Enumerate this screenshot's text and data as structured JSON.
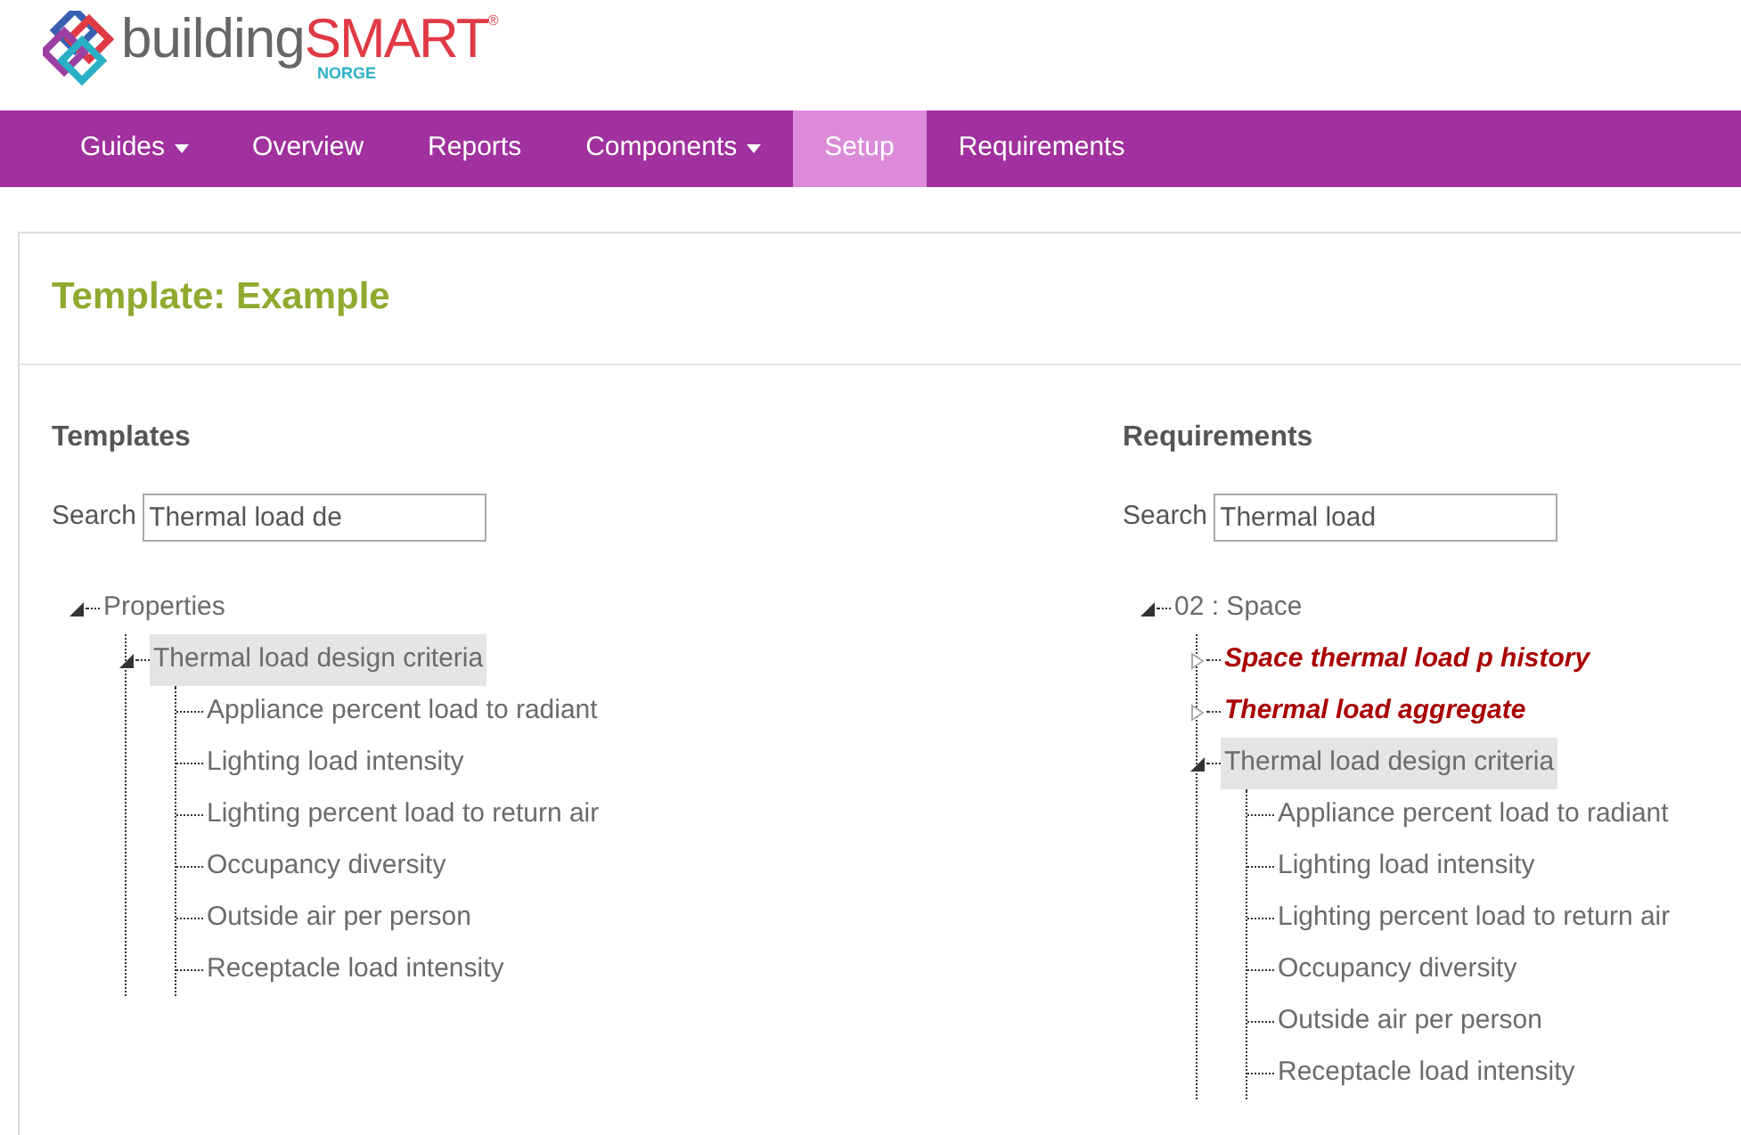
{
  "logo": {
    "wordmark": "building",
    "brand": "SMART",
    "registered": "®",
    "country": "NORGE"
  },
  "nav": [
    {
      "label": "Guides",
      "dropdown": true,
      "selected": false
    },
    {
      "label": "Overview",
      "dropdown": false,
      "selected": false
    },
    {
      "label": "Reports",
      "dropdown": false,
      "selected": false
    },
    {
      "label": "Components",
      "dropdown": true,
      "selected": false
    },
    {
      "label": "Setup",
      "dropdown": false,
      "selected": true
    },
    {
      "label": "Requirements",
      "dropdown": false,
      "selected": false
    }
  ],
  "page_title": "Template: Example",
  "panels": [
    {
      "heading": "Templates",
      "search": {
        "label": "Search",
        "value": "Thermal load de"
      },
      "tree": [
        {
          "label": "Properties",
          "kind": "normal",
          "expanded": true,
          "selected": false,
          "children": [
            {
              "label": "Thermal load design criteria",
              "kind": "normal",
              "expanded": true,
              "selected": true,
              "children": [
                {
                  "label": "Appliance percent load to radiant",
                  "kind": "normal",
                  "selected": false
                },
                {
                  "label": "Lighting load intensity",
                  "kind": "normal",
                  "selected": false
                },
                {
                  "label": "Lighting percent load to return air",
                  "kind": "normal",
                  "selected": false
                },
                {
                  "label": "Occupancy diversity",
                  "kind": "normal",
                  "selected": false
                },
                {
                  "label": "Outside air per person",
                  "kind": "normal",
                  "selected": false
                },
                {
                  "label": "Receptacle load intensity",
                  "kind": "normal",
                  "selected": false
                }
              ]
            }
          ]
        }
      ]
    },
    {
      "heading": "Requirements",
      "search": {
        "label": "Search",
        "value": "Thermal load"
      },
      "tree": [
        {
          "label": "02 : Space",
          "kind": "normal",
          "expanded": true,
          "selected": false,
          "children": [
            {
              "label": "Space thermal load p history",
              "kind": "flagged",
              "expanded": false,
              "selected": false
            },
            {
              "label": "Thermal load aggregate",
              "kind": "flagged",
              "expanded": false,
              "selected": false
            },
            {
              "label": "Thermal load design criteria",
              "kind": "normal",
              "expanded": true,
              "selected": true,
              "children": [
                {
                  "label": "Appliance percent load to radiant",
                  "kind": "normal",
                  "selected": false
                },
                {
                  "label": "Lighting load intensity",
                  "kind": "normal",
                  "selected": false
                },
                {
                  "label": "Lighting percent load to return air",
                  "kind": "normal",
                  "selected": false
                },
                {
                  "label": "Occupancy diversity",
                  "kind": "normal",
                  "selected": false
                },
                {
                  "label": "Outside air per person",
                  "kind": "normal",
                  "selected": false
                },
                {
                  "label": "Receptacle load intensity",
                  "kind": "normal",
                  "selected": false
                }
              ]
            }
          ]
        }
      ]
    }
  ]
}
